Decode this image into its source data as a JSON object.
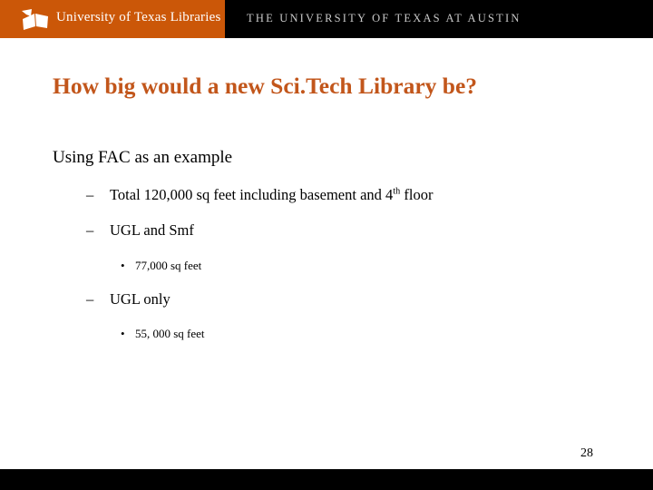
{
  "header": {
    "logo_icon": "open-book-logo-icon",
    "logo_text": "University of Texas Libraries",
    "university_text": "THE UNIVERSITY OF TEXAS AT AUSTIN",
    "orange_color": "#cb5708",
    "bar_color": "#000000"
  },
  "title": {
    "text": "How big would a new Sci.Tech Library be?",
    "color": "#c2561b"
  },
  "content": {
    "heading": "Using FAC as an example",
    "items": [
      {
        "level": 2,
        "marker": "–",
        "text_before": "Total 120,000 sq feet including basement and 4",
        "superscript": "th",
        "text_after": " floor"
      },
      {
        "level": 2,
        "marker": "–",
        "text": "UGL and Smf"
      },
      {
        "level": 3,
        "marker": "•",
        "text": "77,000 sq feet"
      },
      {
        "level": 2,
        "marker": "–",
        "text": "UGL only"
      },
      {
        "level": 3,
        "marker": "•",
        "text": "55, 000 sq feet"
      }
    ]
  },
  "footer": {
    "page_number": "28",
    "bar_color": "#000000"
  }
}
